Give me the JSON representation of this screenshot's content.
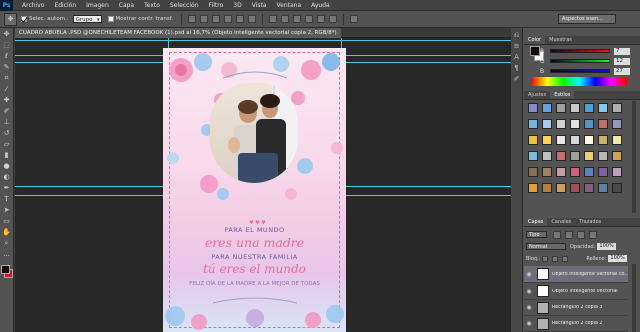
{
  "menubar": {
    "logo": "Ps",
    "items": [
      "Archivo",
      "Edición",
      "Imagen",
      "Capa",
      "Texto",
      "Selección",
      "Filtro",
      "3D",
      "Vista",
      "Ventana",
      "Ayuda"
    ]
  },
  "options": {
    "auto_select_label": "Selec. autom.:",
    "auto_select_value": "Grupo",
    "transform_label": "Mostrar contr. transf.",
    "workspace": "Aspectos esen..."
  },
  "document": {
    "tab_title": "CUADRO ABUELA .PSD @ONECHILETEAM FACEBOOK (1).psd al 16,7% (Objeto inteligente vectorial copia 2, RGB/8*)",
    "close": "×"
  },
  "artwork": {
    "line1": "PARA EL MUNDO",
    "line2": "eres una madre",
    "line3": "PARA NUESTRA FAMILIA",
    "line4": "tú eres el mundo",
    "line5": "FELIZ DÍA DE LA MADRE A LA MEJOR DE TODAS",
    "hearts": "♥ ♥ ♥"
  },
  "color_panel": {
    "tabs": [
      "Color",
      "Muestras"
    ],
    "r_label": "R",
    "r_value": "7",
    "g_label": "G",
    "g_value": "12",
    "b_label": "B",
    "b_value": "27",
    "fg_color": "#120a05"
  },
  "styles_panel": {
    "tabs": [
      "Ajustes",
      "Estilos"
    ],
    "swatch_colors": [
      "#8a8ac8",
      "#6aa0e0",
      "#a0a0a0",
      "#c8c8c8",
      "#4aa0d8",
      "#88c8f0",
      "#b0b0b0",
      "#7ab0e0",
      "#a8c8f0",
      "#d0d0d0",
      "#e0e0e0",
      "#5890c8",
      "#c07070",
      "#9898c0",
      "#f0c040",
      "#ffd060",
      "#e8e8e8",
      "#d8d8d8",
      "#fff8e0",
      "#c8b070",
      "#f0e8b0",
      "#80b8e0",
      "#c0c0c0",
      "#c87070",
      "#a0a0a0",
      "#e8d070",
      "#b8b8b8",
      "#d0a060",
      "#8a7050",
      "#a08060",
      "#c0a0a0",
      "#d06080",
      "#6080c0",
      "#8060a0",
      "#c0a0c0",
      "#e0a040",
      "#b08040",
      "#c8a060",
      "#a05050",
      "#806080",
      "#6080a0",
      "#4a4a4a"
    ]
  },
  "layers_panel": {
    "tabs": [
      "Capas",
      "Canales",
      "Trazados"
    ],
    "filter": "Tipo",
    "blend_mode": "Normal",
    "opacity_label": "Opacidad:",
    "opacity_value": "100%",
    "lock_label": "Bloq.:",
    "fill_label": "Relleno:",
    "fill_value": "100%",
    "layers": [
      {
        "name": "Objeto inteligente vectorial co...",
        "selected": true
      },
      {
        "name": "Objeto inteligente vectorial",
        "selected": false
      },
      {
        "name": "Rectángulo 2 copia 3",
        "selected": false
      },
      {
        "name": "Rectángulo 2 copia 2",
        "selected": false
      }
    ]
  }
}
